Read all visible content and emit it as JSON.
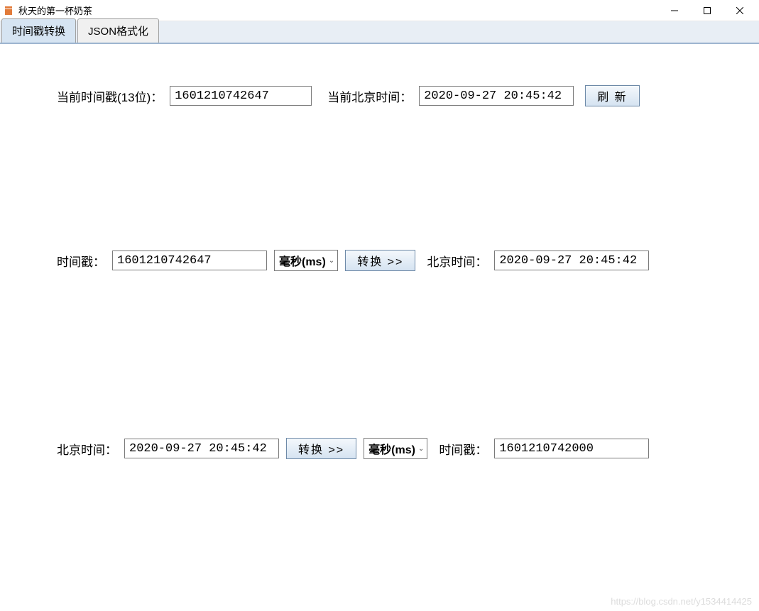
{
  "window": {
    "title": "秋天的第一杯奶茶"
  },
  "tabs": {
    "timestamp": "时间戳转换",
    "json": "JSON格式化"
  },
  "row1": {
    "current_ts_label": "当前时间戳(13位)：",
    "current_ts_value": "1601210742647",
    "current_bj_label": "当前北京时间：",
    "current_bj_value": "2020-09-27 20:45:42",
    "refresh": "刷 新"
  },
  "row2": {
    "ts_label": "时间戳：",
    "ts_value": "1601210742647",
    "unit": "毫秒(ms)",
    "convert": "转换 >>",
    "bj_label": "北京时间：",
    "bj_value": "2020-09-27 20:45:42"
  },
  "row3": {
    "bj_label": "北京时间：",
    "bj_value": "2020-09-27 20:45:42",
    "convert": "转换 >>",
    "unit": "毫秒(ms)",
    "ts_label": "时间戳：",
    "ts_value": "1601210742000"
  },
  "watermark": "https://blog.csdn.net/y1534414425"
}
